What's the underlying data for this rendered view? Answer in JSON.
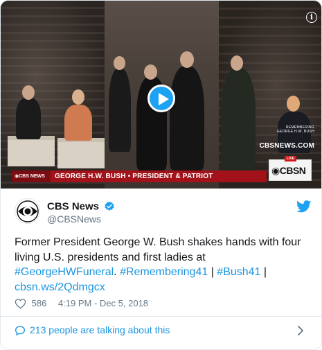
{
  "media": {
    "overlay_site": "CBSNEWS.COM",
    "overlay_small_line1": "REMEMBERING",
    "overlay_small_line2": "GEORGE H.W. BUSH",
    "live_label": "LIVE",
    "live_brand": "CBSN",
    "ticker_tag": "CBS NEWS",
    "ticker_headline": "GEORGE H.W. BUSH • PRESIDENT & PATRIOT",
    "play_icon": "play-icon",
    "info_icon": "info-icon"
  },
  "author": {
    "display_name": "CBS News",
    "handle": "@CBSNews",
    "avatar_icon": "cbs-eye-logo",
    "verified_icon": "verified-badge-icon",
    "platform_icon": "twitter-bird-icon"
  },
  "tweet": {
    "text_plain": "Former President George W. Bush shakes hands with four living U.S. presidents and first ladies at",
    "hashtag1": "#GeorgeHWFuneral",
    "sep1": ". ",
    "hashtag2": "#Remembering41",
    "sep2": " | ",
    "hashtag3": "#Bush41",
    "sep3": " | ",
    "link": "cbsn.ws/2Qdmgcx"
  },
  "meta": {
    "like_count": "586",
    "timestamp": "4:19 PM - Dec 5, 2018"
  },
  "footer": {
    "talk_text": "213 people are talking about this"
  },
  "colors": {
    "link_blue": "#1b95e0",
    "twitter_blue": "#1da1f2",
    "muted_gray": "#657786",
    "ticker_red": "#a3121a"
  }
}
